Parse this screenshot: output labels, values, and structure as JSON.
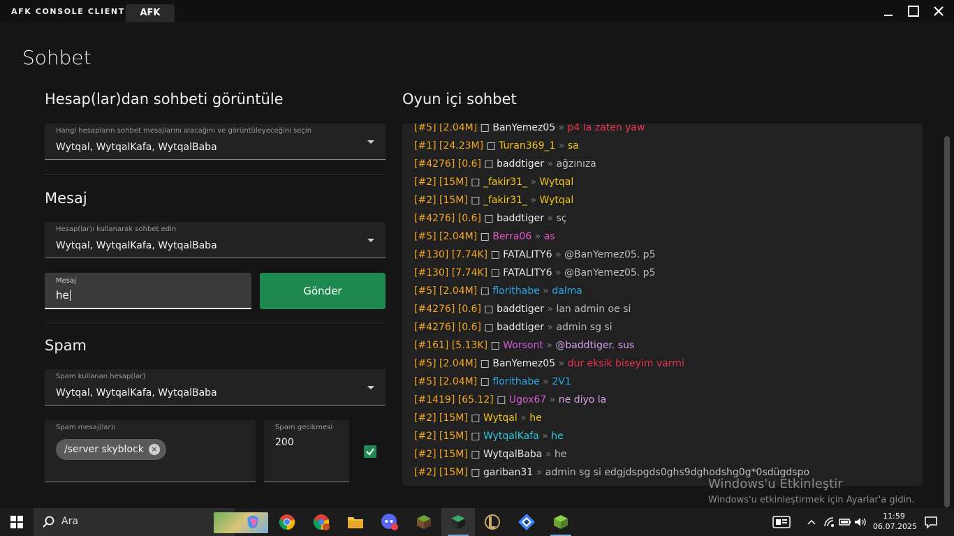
{
  "titlebar": {
    "app_title": "AFK CONSOLE CLIENT",
    "tab": "AFK"
  },
  "page": {
    "title": "Sohbet"
  },
  "view_section": {
    "title": "Hesap(lar)dan sohbeti görüntüle",
    "select_label": "Hangi hesapların sohbet mesajlarını alacağını ve görüntüleyeceğini seçin",
    "select_value": "Wytqal, WytqalKafa, WytqalBaba"
  },
  "message_section": {
    "title": "Mesaj",
    "select_label": "Hesap(lar)ı kullanarak sohbet edin",
    "select_value": "Wytqal, WytqalKafa, WytqalBaba",
    "input_label": "Mesaj",
    "input_value": "he",
    "send_label": "Gönder"
  },
  "spam_section": {
    "title": "Spam",
    "select_label": "Spam kullanan hesap(lar)",
    "select_value": "Wytqal, WytqalKafa, WytqalBaba",
    "messages_label": "Spam mesaj(lar)ı",
    "chip": "/server skyblock",
    "delay_label": "Spam gecikmesi",
    "delay_value": "200",
    "enabled": true
  },
  "chat": {
    "title": "Oyun içi sohbet",
    "lines": [
      {
        "rank": "[#5]",
        "money": "[2.04M]",
        "icon": "□",
        "name": "BanYemez05",
        "sep": "»",
        "msg": "p4 la zaten yaw",
        "name_color": "#e8e8e8",
        "msg_color": "#e8344e"
      },
      {
        "rank": "[#1]",
        "money": "[24.23M]",
        "icon": "□",
        "name": "Turan369_1",
        "sep": "»",
        "msg": "sa",
        "name_color": "#f5c518",
        "msg_color": "#f5c518"
      },
      {
        "rank": "[#4276]",
        "money": "[0.6]",
        "icon": "□",
        "name": "baddtiger",
        "sep": "»",
        "msg": "ağzınıza",
        "name_color": "#e8e8e8",
        "msg_color": "#bdbdbd"
      },
      {
        "rank": "[#2]",
        "money": "[15M]",
        "icon": "□",
        "name": "_fakir31_",
        "sep": "»",
        "msg": "Wytqal",
        "name_color": "#f5c518",
        "msg_color": "#f5c518"
      },
      {
        "rank": "[#2]",
        "money": "[15M]",
        "icon": "□",
        "name": "_fakir31_",
        "sep": "»",
        "msg": "Wytqal",
        "name_color": "#f5c518",
        "msg_color": "#f5c518"
      },
      {
        "rank": "[#4276]",
        "money": "[0.6]",
        "icon": "□",
        "name": "baddtiger",
        "sep": "»",
        "msg": "sç",
        "name_color": "#e8e8e8",
        "msg_color": "#bdbdbd"
      },
      {
        "rank": "[#5]",
        "money": "[2.04M]",
        "icon": "□",
        "name": "Berra06",
        "sep": "»",
        "msg": "as",
        "name_color": "#e858c8",
        "msg_color": "#e858c8"
      },
      {
        "rank": "[#130]",
        "money": "[7.74K]",
        "icon": "□",
        "name": "FATALITY6",
        "sep": "»",
        "msg": "@BanYemez05. p5",
        "name_color": "#e8e8e8",
        "msg_color": "#bdbdbd"
      },
      {
        "rank": "[#130]",
        "money": "[7.74K]",
        "icon": "□",
        "name": "FATALITY6",
        "sep": "»",
        "msg": "@BanYemez05. p5",
        "name_color": "#e8e8e8",
        "msg_color": "#bdbdbd"
      },
      {
        "rank": "[#5]",
        "money": "[2.04M]",
        "icon": "□",
        "name": "florithabe",
        "sep": "»",
        "msg": "dalma",
        "name_color": "#2aa5e8",
        "msg_color": "#2aa5e8"
      },
      {
        "rank": "[#4276]",
        "money": "[0.6]",
        "icon": "□",
        "name": "baddtiger",
        "sep": "»",
        "msg": "lan admin oe si",
        "name_color": "#e8e8e8",
        "msg_color": "#bdbdbd"
      },
      {
        "rank": "[#4276]",
        "money": "[0.6]",
        "icon": "□",
        "name": "baddtiger",
        "sep": "»",
        "msg": "admin sg si",
        "name_color": "#e8e8e8",
        "msg_color": "#bdbdbd"
      },
      {
        "rank": "[#161]",
        "money": "[5.13K]",
        "icon": "□",
        "name": "Worsont",
        "sep": "»",
        "msg": "@baddtiger. sus",
        "name_color": "#d85ad8",
        "msg_color": "#d8a0f0"
      },
      {
        "rank": "[#5]",
        "money": "[2.04M]",
        "icon": "□",
        "name": "BanYemez05",
        "sep": "»",
        "msg": "dur eksik biseyim varmi",
        "name_color": "#e8e8e8",
        "msg_color": "#e8344e"
      },
      {
        "rank": "[#5]",
        "money": "[2.04M]",
        "icon": "□",
        "name": "florithabe",
        "sep": "»",
        "msg": "2V1",
        "name_color": "#2aa5e8",
        "msg_color": "#2aa5e8"
      },
      {
        "rank": "[#1419]",
        "money": "[65.12]",
        "icon": "□",
        "name": "Ugox67",
        "sep": "»",
        "msg": "ne diyo la",
        "name_color": "#d85ad8",
        "msg_color": "#d8a0f0"
      },
      {
        "rank": "[#2]",
        "money": "[15M]",
        "icon": "□",
        "name": "Wytqal",
        "sep": "»",
        "msg": "he",
        "name_color": "#f5c518",
        "msg_color": "#f5c518"
      },
      {
        "rank": "[#2]",
        "money": "[15M]",
        "icon": "□",
        "name": "WytqalKafa",
        "sep": "»",
        "msg": "he",
        "name_color": "#2bc8e0",
        "msg_color": "#2bc8e0"
      },
      {
        "rank": "[#2]",
        "money": "[15M]",
        "icon": "□",
        "name": "WytqalBaba",
        "sep": "»",
        "msg": "he",
        "name_color": "#e8e8e8",
        "msg_color": "#bdbdbd"
      },
      {
        "rank": "[#2]",
        "money": "[15M]",
        "icon": "□",
        "name": "gariban31",
        "sep": "»",
        "msg": "admin sg si edgjdspgds0ghs9dghodshg0g*0sdügdspo",
        "name_color": "#e8e8e8",
        "msg_color": "#bdbdbd"
      }
    ]
  },
  "watermark": {
    "title": "Windows'u Etkinleştir",
    "subtitle": "Windows'u etkinleştirmek için Ayarlar'a gidin."
  },
  "taskbar": {
    "search_placeholder": "Ara",
    "time": "11:59",
    "date": "06.07.2025"
  },
  "colors": {
    "accent": "#1e8a4f",
    "rank": "#f5a623",
    "money": "#f5a623",
    "background": "#151515",
    "panel": "#222222"
  }
}
